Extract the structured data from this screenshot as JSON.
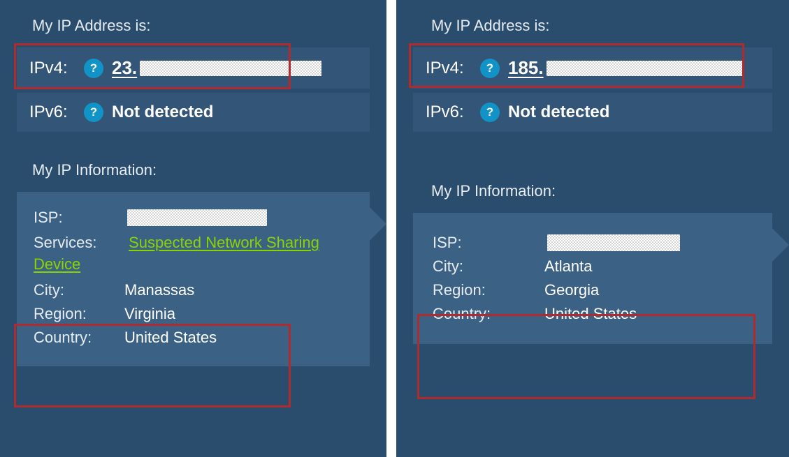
{
  "left": {
    "title_ip": "My IP Address is:",
    "ipv4_label": "IPv4:",
    "ipv4_prefix": "23.",
    "ipv6_label": "IPv6:",
    "ipv6_value": "Not detected",
    "title_info": "My IP Information:",
    "isp_label": "ISP:",
    "services_label": "Services:",
    "services_value": "Suspected Network Sharing Device",
    "city_label": "City:",
    "city_value": "Manassas",
    "region_label": "Region:",
    "region_value": "Virginia",
    "country_label": "Country:",
    "country_value": "United States",
    "help_glyph": "?"
  },
  "right": {
    "title_ip": "My IP Address is:",
    "ipv4_label": "IPv4:",
    "ipv4_prefix": "185.",
    "ipv6_label": "IPv6:",
    "ipv6_value": "Not detected",
    "title_info": "My IP Information:",
    "isp_label": "ISP:",
    "city_label": "City:",
    "city_value": "Atlanta",
    "region_label": "Region:",
    "region_value": "Georgia",
    "country_label": "Country:",
    "country_value": "United States",
    "help_glyph": "?"
  },
  "colors": {
    "panel_bg": "#2a4d6e",
    "row_bg": "#335577",
    "info_bg": "#3b6184",
    "accent": "#1193c7",
    "link": "#8cd400",
    "highlight": "#b02a2e"
  }
}
